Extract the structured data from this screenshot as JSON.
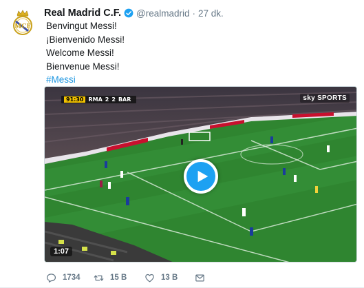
{
  "author": {
    "name": "Real Madrid C.F.",
    "handle": "@realmadrid",
    "time": "27 dk."
  },
  "tweet": {
    "lines": [
      "Benvingut Messi!",
      "¡Bienvenido Messi!",
      "Welcome Messi!",
      "Bienvenue Messi!"
    ],
    "hashtag": "#Messi"
  },
  "media": {
    "type": "video",
    "duration": "1:07",
    "scoreboard": {
      "clock": "91:30",
      "home": "RMA",
      "home_score": "2",
      "away_score": "2",
      "away": "BAR"
    },
    "broadcaster": "sky SPORTS"
  },
  "actions": {
    "reply_count": "1734",
    "retweet_count": "15 B",
    "like_count": "13 B"
  },
  "colors": {
    "accent": "#1da1f2",
    "hashtag": "#1b95e0",
    "secondary_text": "#657786"
  },
  "icons": {
    "avatar": "real-madrid-crest",
    "verified": "verified-badge-icon",
    "play": "play-icon",
    "reply": "reply-icon",
    "retweet": "retweet-icon",
    "like": "heart-icon",
    "dm": "envelope-icon"
  }
}
